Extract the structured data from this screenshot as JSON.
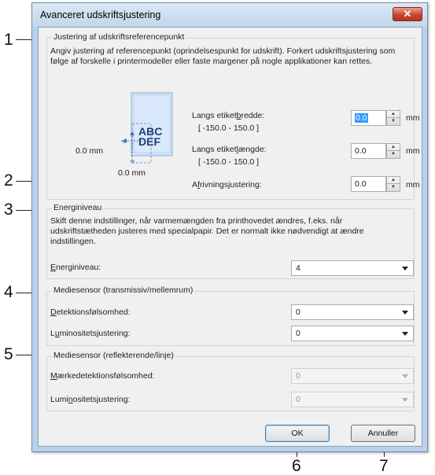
{
  "dialog": {
    "title": "Avanceret udskriftsjustering",
    "close_symbol": "✕"
  },
  "callouts": [
    "1",
    "2",
    "3",
    "4",
    "5",
    "6",
    "7"
  ],
  "reference_point": {
    "legend": "Justering af udskriftsreferencepunkt",
    "description_line1": "Angiv justering af referencepunkt (oprindelsespunkt for udskrift). Forkert udskriftsjustering som",
    "description_line2": "følge af forskelle i printermodeller eller faste margener på nogle applikationer kan rettes.",
    "illustration": {
      "label_line1": "ABC",
      "label_line2": "DEF",
      "x_offset_text": "0.0 mm",
      "y_offset_text": "0.0 mm"
    },
    "width": {
      "label_pre": "Langs etiket",
      "label_key": "b",
      "label_post": "redde:",
      "range": "[ -150.0 - 150.0 ]",
      "value": "0.0",
      "unit": "mm"
    },
    "length": {
      "label_pre": "Langs etiket",
      "label_key": "l",
      "label_post": "ængde:",
      "range": "[ -150.0 - 150.0 ]",
      "value": "0.0",
      "unit": "mm"
    },
    "tear": {
      "label_pre": "A",
      "label_key": "f",
      "label_post": "rivningsjustering:",
      "value": "0.0",
      "unit": "mm"
    }
  },
  "energy": {
    "legend": "Energiniveau",
    "description_line1": "Skift denne indstillinger, når varmemængden fra printhovedet ændres, f.eks. når",
    "description_line2": "udskriftstætheden justeres med specialpapir. Det er normalt ikke nødvendigt at ændre",
    "description_line3": "indstillingen.",
    "label_key": "E",
    "label_post": "nerginiveau:",
    "value": "4"
  },
  "sensor_trans": {
    "legend": "Mediesensor (transmissiv/mellemrum)",
    "detection": {
      "label_key": "D",
      "label_post": "etektionsfølsomhed:",
      "value": "0"
    },
    "luminosity": {
      "label_pre": "L",
      "label_key": "u",
      "label_post": "minositetsjustering:",
      "value": "0"
    }
  },
  "sensor_refl": {
    "legend": "Mediesensor (reflekterende/linje)",
    "detection": {
      "label_key": "M",
      "label_post": "ærkedetektionsfølsomhed:",
      "value": "0"
    },
    "luminosity": {
      "label_pre": "Lumi",
      "label_key": "n",
      "label_post": "ositetsjustering:",
      "value": "0"
    }
  },
  "buttons": {
    "ok": "OK",
    "cancel": "Annuller"
  }
}
